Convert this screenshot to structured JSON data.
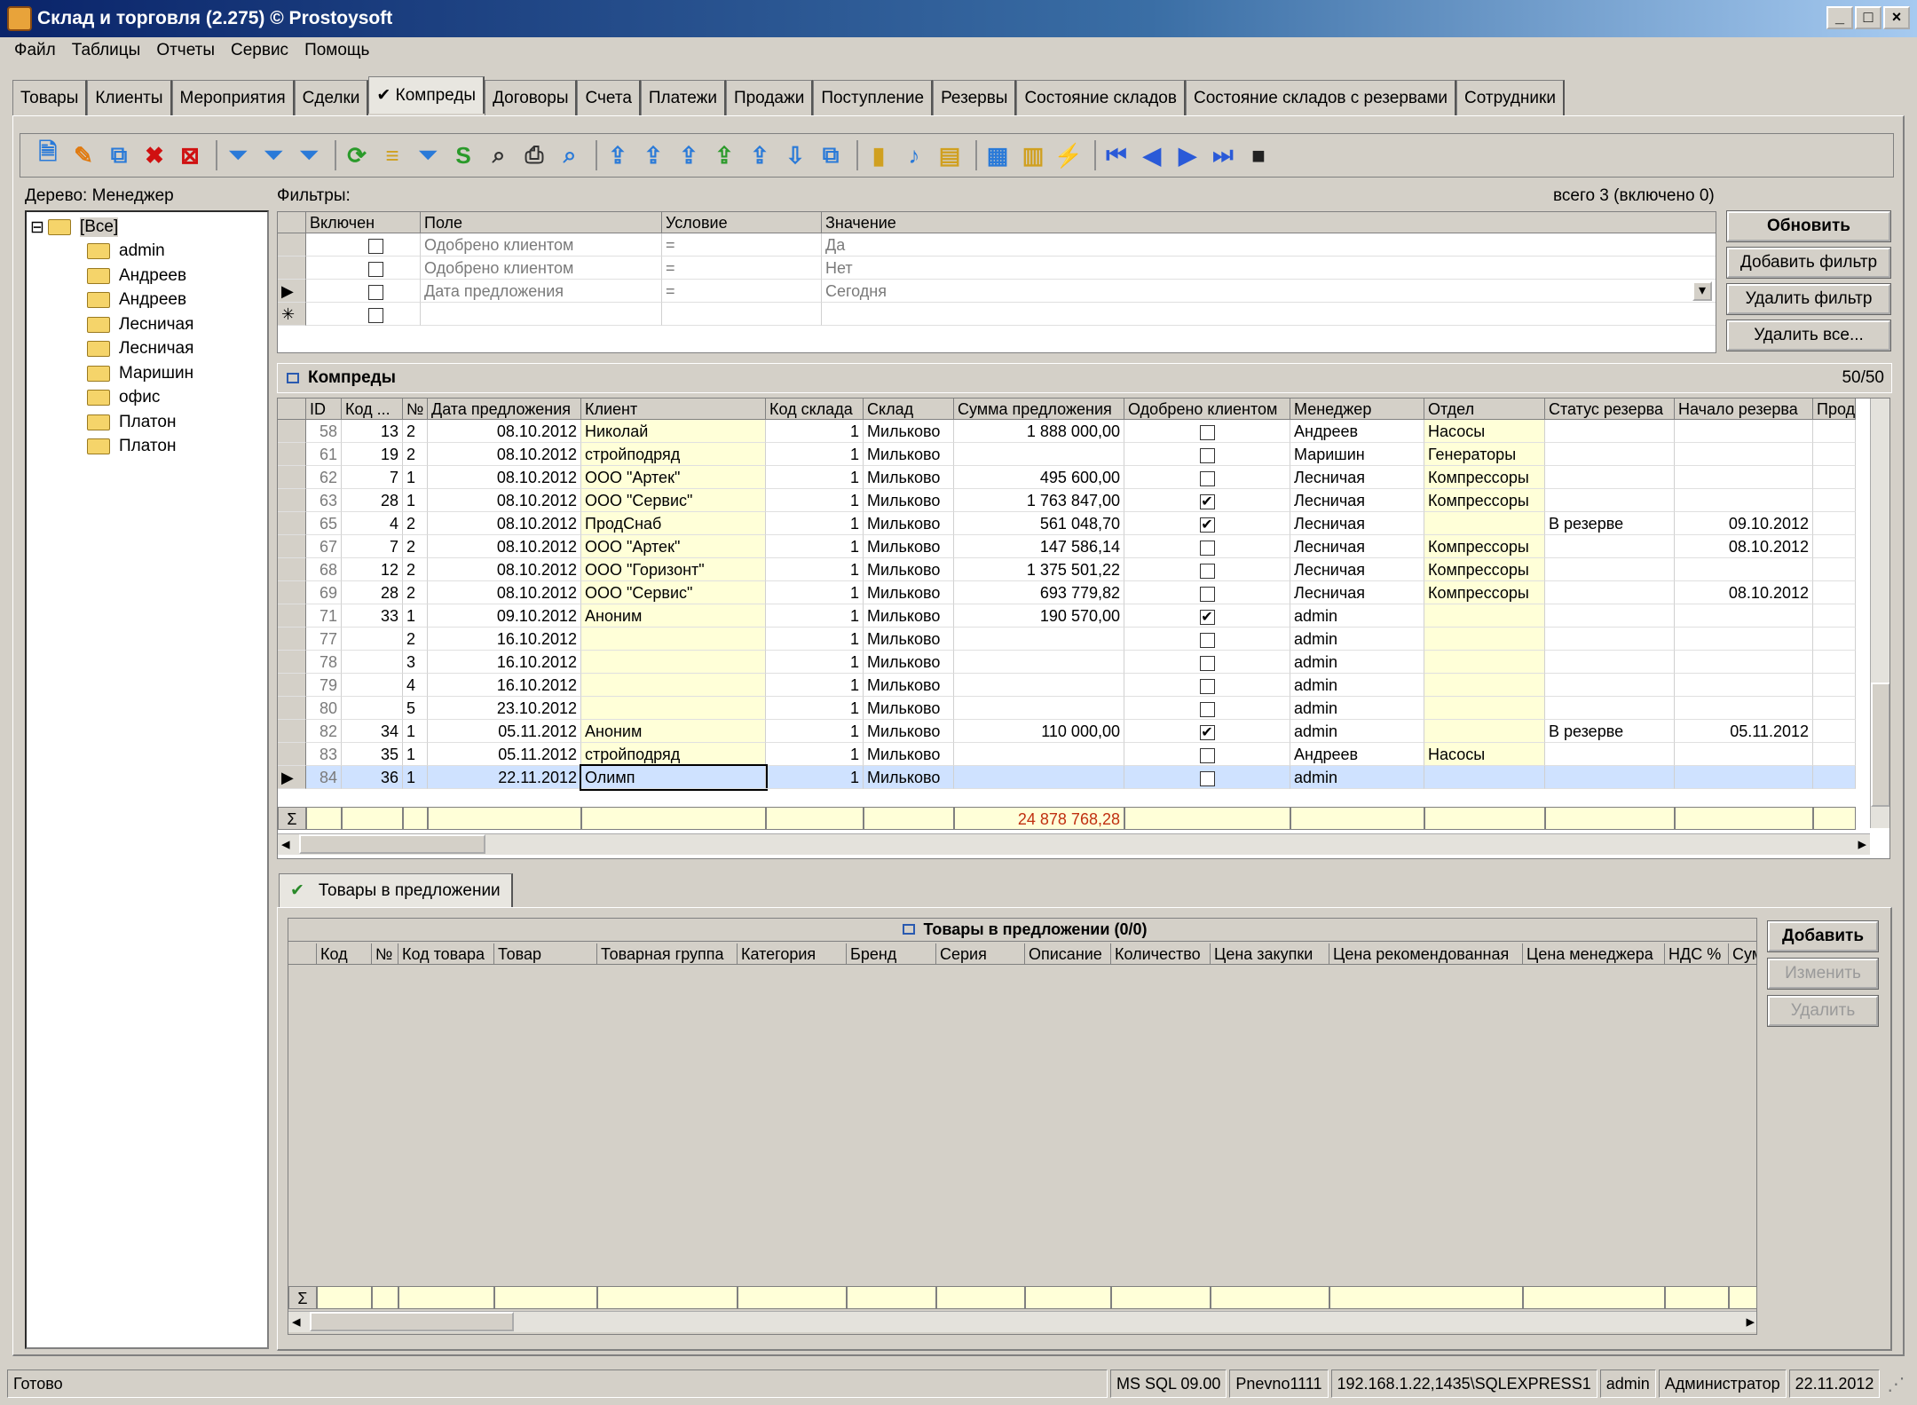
{
  "window": {
    "title": "Склад и торговля (2.275) © Prostoysoft"
  },
  "menu": [
    "Файл",
    "Таблицы",
    "Отчеты",
    "Сервис",
    "Помощь"
  ],
  "tabs": [
    "Товары",
    "Клиенты",
    "Мероприятия",
    "Сделки",
    "✔ Компреды",
    "Договоры",
    "Счета",
    "Платежи",
    "Продажи",
    "Поступление",
    "Резервы",
    "Состояние складов",
    "Состояние складов с резервами",
    "Сотрудники"
  ],
  "active_tab": "✔ Компреды",
  "toolbar_icons": [
    "new-record-icon",
    "edit-icon",
    "copy-icon",
    "delete-icon",
    "delete-all-icon",
    "filter-icon",
    "filter-add-icon",
    "filter-clear-icon",
    "refresh-icon",
    "tree-icon",
    "filter-active-icon",
    "sql-filter-icon",
    "binoculars-icon",
    "print-icon",
    "preview-icon",
    "export-icon",
    "export-csv-icon",
    "export-xml-icon",
    "export-excel-icon",
    "export-html-icon",
    "import-icon",
    "copy-data-icon",
    "chart-icon",
    "note-icon",
    "report-icon",
    "table-icon",
    "settings-icon",
    "lightning-icon",
    "first-record-icon",
    "prev-record-icon",
    "next-record-icon",
    "last-record-icon",
    "stop-icon"
  ],
  "tree": {
    "label": "Дерево: Менеджер",
    "root": "[Все]",
    "items": [
      "admin",
      "Андреев",
      "Андреев",
      "Лесничая",
      "Лесничая",
      "Маришин",
      "офис",
      "Платон",
      "Платон"
    ]
  },
  "filters": {
    "label": "Фильтры:",
    "total": "всего 3 (включено 0)",
    "columns": [
      "Включен",
      "Поле",
      "Условие",
      "Значение"
    ],
    "rows": [
      {
        "field": "Одобрено клиентом",
        "cond": "=",
        "value": "Да"
      },
      {
        "field": "Одобрено клиентом",
        "cond": "=",
        "value": "Нет"
      },
      {
        "field": "Дата предложения",
        "cond": "=",
        "value": "Сегодня"
      }
    ],
    "buttons": {
      "refresh": "Обновить",
      "add": "Добавить фильтр",
      "remove": "Удалить фильтр",
      "remove_all": "Удалить все..."
    }
  },
  "kompredy": {
    "title": "Компреды",
    "count": "50/50",
    "columns": [
      "ID",
      "Код ...",
      "№",
      "Дата предложения",
      "Клиент",
      "Код склада",
      "Склад",
      "Сумма предложения",
      "Одобрено клиентом",
      "Менеджер",
      "Отдел",
      "Статус резерва",
      "Начало резерва",
      "Прод"
    ],
    "rows": [
      {
        "id": "58",
        "kod": "13",
        "n": "2",
        "date": "08.10.2012",
        "client": "Николай",
        "sklad_kod": "1",
        "sklad": "Мильково",
        "sum": "1 888 000,00",
        "ok": false,
        "manager": "Андреев",
        "otdel": "Насосы",
        "status": "",
        "start": ""
      },
      {
        "id": "61",
        "kod": "19",
        "n": "2",
        "date": "08.10.2012",
        "client": "стройподряд",
        "sklad_kod": "1",
        "sklad": "Мильково",
        "sum": "",
        "ok": false,
        "manager": "Маришин",
        "otdel": "Генераторы",
        "status": "",
        "start": ""
      },
      {
        "id": "62",
        "kod": "7",
        "n": "1",
        "date": "08.10.2012",
        "client": "ООО \"Артек\"",
        "sklad_kod": "1",
        "sklad": "Мильково",
        "sum": "495 600,00",
        "ok": false,
        "manager": "Лесничая",
        "otdel": "Компрессоры",
        "status": "",
        "start": ""
      },
      {
        "id": "63",
        "kod": "28",
        "n": "1",
        "date": "08.10.2012",
        "client": "ООО \"Сервис\"",
        "sklad_kod": "1",
        "sklad": "Мильково",
        "sum": "1 763 847,00",
        "ok": true,
        "manager": "Лесничая",
        "otdel": "Компрессоры",
        "status": "",
        "start": ""
      },
      {
        "id": "65",
        "kod": "4",
        "n": "2",
        "date": "08.10.2012",
        "client": "ПродСнаб",
        "sklad_kod": "1",
        "sklad": "Мильково",
        "sum": "561 048,70",
        "ok": true,
        "manager": "Лесничая",
        "otdel": "",
        "status": "В резерве",
        "start": "09.10.2012"
      },
      {
        "id": "67",
        "kod": "7",
        "n": "2",
        "date": "08.10.2012",
        "client": "ООО \"Артек\"",
        "sklad_kod": "1",
        "sklad": "Мильково",
        "sum": "147 586,14",
        "ok": false,
        "manager": "Лесничая",
        "otdel": "Компрессоры",
        "status": "",
        "start": "08.10.2012"
      },
      {
        "id": "68",
        "kod": "12",
        "n": "2",
        "date": "08.10.2012",
        "client": "ООО \"Горизонт\"",
        "sklad_kod": "1",
        "sklad": "Мильково",
        "sum": "1 375 501,22",
        "ok": false,
        "manager": "Лесничая",
        "otdel": "Компрессоры",
        "status": "",
        "start": ""
      },
      {
        "id": "69",
        "kod": "28",
        "n": "2",
        "date": "08.10.2012",
        "client": "ООО \"Сервис\"",
        "sklad_kod": "1",
        "sklad": "Мильково",
        "sum": "693 779,82",
        "ok": false,
        "manager": "Лесничая",
        "otdel": "Компрессоры",
        "status": "",
        "start": "08.10.2012"
      },
      {
        "id": "71",
        "kod": "33",
        "n": "1",
        "date": "09.10.2012",
        "client": "Аноним",
        "sklad_kod": "1",
        "sklad": "Мильково",
        "sum": "190 570,00",
        "ok": true,
        "manager": "admin",
        "otdel": "",
        "status": "",
        "start": ""
      },
      {
        "id": "77",
        "kod": "",
        "n": "2",
        "date": "16.10.2012",
        "client": "",
        "sklad_kod": "1",
        "sklad": "Мильково",
        "sum": "",
        "ok": false,
        "manager": "admin",
        "otdel": "",
        "status": "",
        "start": ""
      },
      {
        "id": "78",
        "kod": "",
        "n": "3",
        "date": "16.10.2012",
        "client": "",
        "sklad_kod": "1",
        "sklad": "Мильково",
        "sum": "",
        "ok": false,
        "manager": "admin",
        "otdel": "",
        "status": "",
        "start": ""
      },
      {
        "id": "79",
        "kod": "",
        "n": "4",
        "date": "16.10.2012",
        "client": "",
        "sklad_kod": "1",
        "sklad": "Мильково",
        "sum": "",
        "ok": false,
        "manager": "admin",
        "otdel": "",
        "status": "",
        "start": ""
      },
      {
        "id": "80",
        "kod": "",
        "n": "5",
        "date": "23.10.2012",
        "client": "",
        "sklad_kod": "1",
        "sklad": "Мильково",
        "sum": "",
        "ok": false,
        "manager": "admin",
        "otdel": "",
        "status": "",
        "start": ""
      },
      {
        "id": "82",
        "kod": "34",
        "n": "1",
        "date": "05.11.2012",
        "client": "Аноним",
        "sklad_kod": "1",
        "sklad": "Мильково",
        "sum": "110 000,00",
        "ok": true,
        "manager": "admin",
        "otdel": "",
        "status": "В резерве",
        "start": "05.11.2012"
      },
      {
        "id": "83",
        "kod": "35",
        "n": "1",
        "date": "05.11.2012",
        "client": "стройподряд",
        "sklad_kod": "1",
        "sklad": "Мильково",
        "sum": "",
        "ok": false,
        "manager": "Андреев",
        "otdel": "Насосы",
        "status": "",
        "start": ""
      },
      {
        "id": "84",
        "kod": "36",
        "n": "1",
        "date": "22.11.2012",
        "client": "Олимп",
        "sklad_kod": "1",
        "sklad": "Мильково",
        "sum": "",
        "ok": false,
        "manager": "admin",
        "otdel": "",
        "status": "",
        "start": ""
      }
    ],
    "total_sum": "24 878 768,28",
    "sigma": "Σ"
  },
  "goods_tab": {
    "label": "Товары в предложении"
  },
  "goods": {
    "title": "Товары в предложении (0/0)",
    "columns": [
      "Код",
      "№",
      "Код товара",
      "Товар",
      "Товарная группа",
      "Категория",
      "Бренд",
      "Серия",
      "Описание",
      "Количество",
      "Цена закупки",
      "Цена рекомендованная",
      "Цена менеджера",
      "НДС %",
      "Сум"
    ],
    "buttons": {
      "add": "Добавить",
      "edit": "Изменить",
      "delete": "Удалить"
    },
    "sigma": "Σ"
  },
  "status": {
    "left": "Готово",
    "panels": [
      "MS SQL 09.00",
      "Pnevno1111",
      "192.168.1.22,1435\\SQLEXPRESS1",
      "admin",
      "Администратор",
      "22.11.2012"
    ]
  }
}
